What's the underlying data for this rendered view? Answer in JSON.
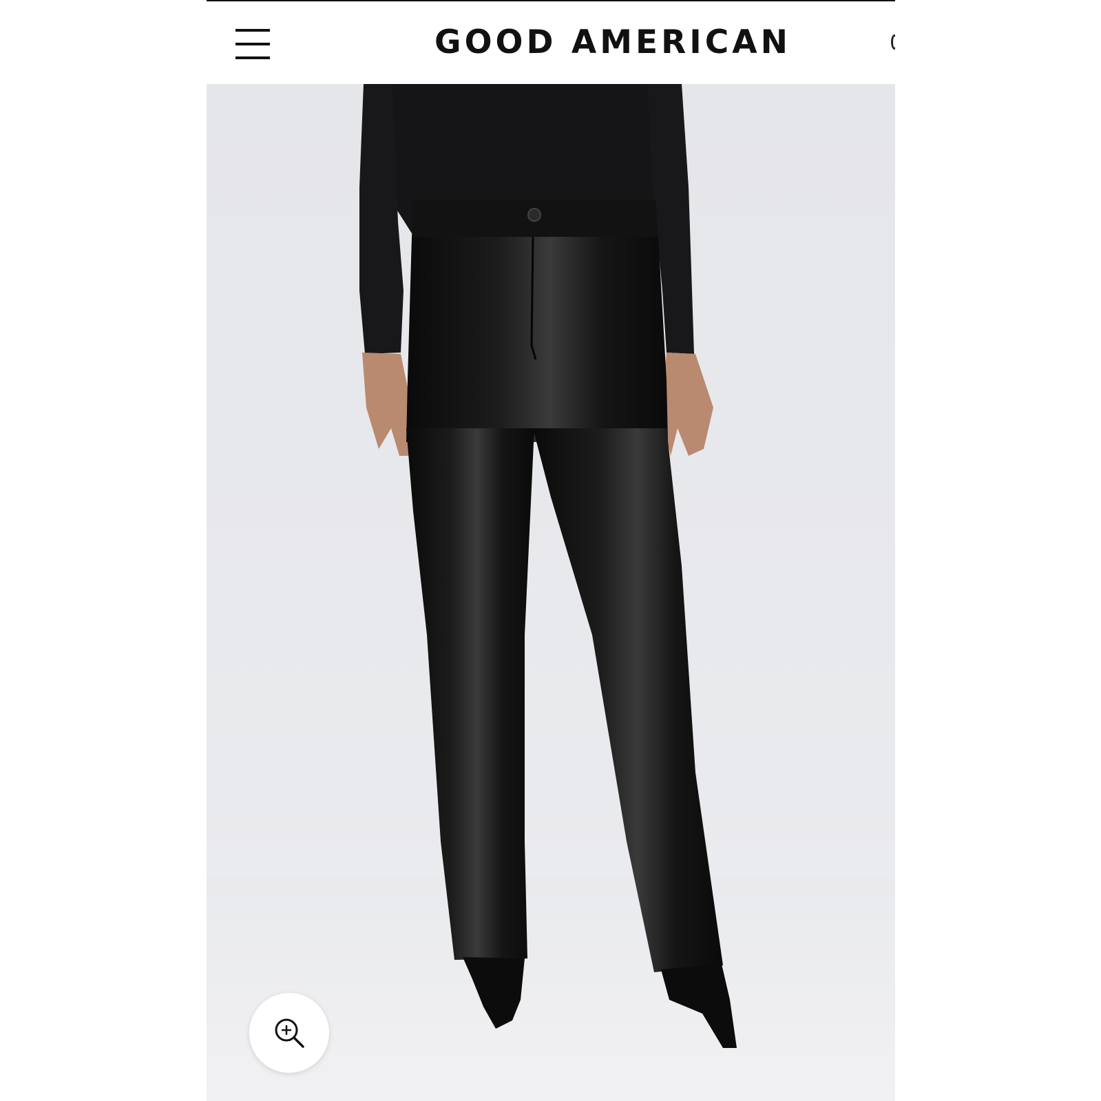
{
  "header": {
    "brand": "GOOD AMERICAN"
  },
  "icons": {
    "menu": "hamburger-menu-icon",
    "cart": "cart-icon",
    "zoom": "zoom-in-icon"
  },
  "colors": {
    "background": "#ffffff",
    "photo_backdrop": "#e7e8ec",
    "product": "#101010",
    "text": "#111111"
  }
}
